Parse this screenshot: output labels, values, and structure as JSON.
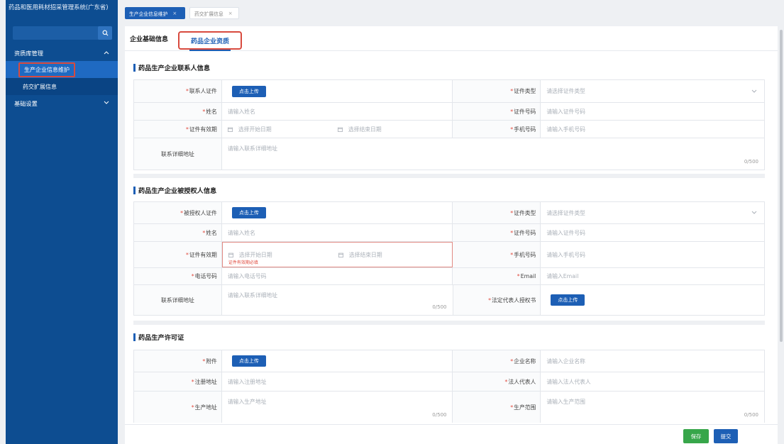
{
  "app": {
    "title": "药品和医用耗材招采管理系统(广东省)"
  },
  "sidebar": {
    "search_placeholder": "",
    "groups": [
      {
        "label": "资质库管理",
        "items": [
          {
            "label": "生产企业信息维护"
          },
          {
            "label": "药交扩展信息"
          }
        ]
      },
      {
        "label": "基础设置",
        "items": []
      }
    ]
  },
  "top_tabs": [
    {
      "label": "生产企业信息维护",
      "close": "×"
    },
    {
      "label": "药交扩展信息",
      "close": "×"
    }
  ],
  "sub_tabs": [
    {
      "label": "企业基础信息"
    },
    {
      "label": "药品企业资质"
    }
  ],
  "common": {
    "upload": "点击上传",
    "cert_type_ph": "请选择证件类型",
    "name_ph": "请输入姓名",
    "cert_no_ph": "请输入证件号码",
    "start_date_ph": "选择开始日期",
    "end_date_ph": "选择结束日期",
    "phone_ph": "请输入手机号码",
    "address_ph": "请输入联系详细地址",
    "counter": "0/500",
    "req": "*"
  },
  "section1": {
    "title": "药品生产企业联系人信息",
    "labels": {
      "contact_cert": "联系人证件",
      "cert_type": "证件类型",
      "name": "姓名",
      "cert_no": "证件号码",
      "validity": "证件有效期",
      "mobile": "手机号码",
      "address": "联系详细地址"
    }
  },
  "section2": {
    "title": "药品生产企业被授权人信息",
    "labels": {
      "auth_cert": "被授权人证件",
      "cert_type": "证件类型",
      "name": "姓名",
      "cert_no": "证件号码",
      "validity": "证件有效期",
      "mobile": "手机号码",
      "tel": "电话号码",
      "email": "Email",
      "address": "联系详细地址",
      "legal_auth": "法定代表人授权书"
    },
    "tel_ph": "请输入电话号码",
    "email_ph": "请输入Email",
    "validity_error": "证件有效期必填"
  },
  "section3": {
    "title": "药品生产许可证",
    "labels": {
      "attachment": "附件",
      "company_name": "企业名称",
      "reg_address": "注册地址",
      "legal_rep": "法人代表人",
      "prod_address": "生产地址",
      "prod_scope": "生产范围"
    },
    "company_name_ph": "请输入企业名称",
    "reg_address_ph": "请输入注册地址",
    "legal_rep_ph": "请输入法人代表人",
    "prod_address_ph": "请输入生产地址",
    "prod_scope_ph": "请输入生产范围"
  },
  "footer": {
    "save": "保存",
    "submit": "提交"
  },
  "colors": {
    "sidebar": "#0d4d91",
    "primary": "#1d5fb5",
    "save": "#37a64a",
    "highlight": "#d84a3e"
  }
}
